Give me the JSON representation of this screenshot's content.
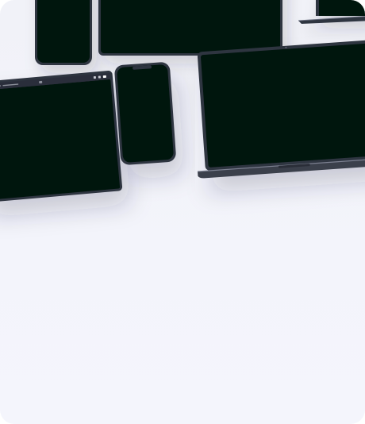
{
  "card": {
    "background": "#f2f3fa"
  },
  "devices": {
    "screen_color": "#00140e",
    "frame_color": "#2f3440",
    "tablet_browser_bar": {
      "url_text": "",
      "icons": [
        "dot-icon",
        "share-icon",
        "plus-icon",
        "tabs-icon"
      ]
    }
  }
}
